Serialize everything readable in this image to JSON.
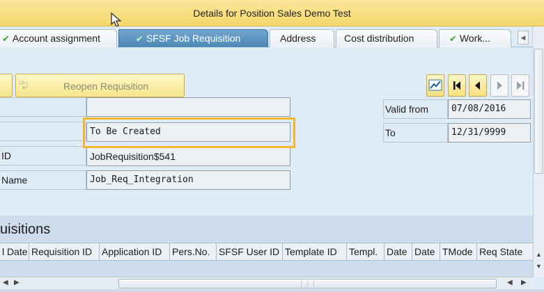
{
  "title_bar": {
    "title": "Details for Position Sales Demo Test"
  },
  "tabs": [
    {
      "label": "Account assignment",
      "checked": true,
      "active": false
    },
    {
      "label": "SFSF Job Requisition",
      "checked": true,
      "active": true
    },
    {
      "label": "Address",
      "checked": false,
      "active": false
    },
    {
      "label": "Cost distribution",
      "checked": false,
      "active": false
    },
    {
      "label": "Work...",
      "checked": true,
      "active": false
    }
  ],
  "toolbar": {
    "reopen_label": "Reopen Requisition",
    "chart_icon": "trend-chart-icon",
    "first_icon": "first-page-icon",
    "prev_icon": "previous-icon",
    "next_icon": "next-icon",
    "last_icon": "last-page-icon"
  },
  "form": {
    "fields": [
      {
        "label": "",
        "value": ""
      },
      {
        "label": "",
        "value": "To Be Created"
      },
      {
        "label": "ID",
        "value": "JobRequisition$541"
      },
      {
        "label": "Name",
        "value": "Job_Req_Integration"
      }
    ],
    "valid_from": {
      "label": "Valid from",
      "value": "07/08/2016"
    },
    "to": {
      "label": "To",
      "value": "12/31/9999"
    }
  },
  "requisitions": {
    "title": "uisitions",
    "columns": [
      "l Date",
      "Requisition ID",
      "Application ID",
      "Pers.No.",
      "SFSF User ID",
      "Template ID",
      "Templ.",
      "Date",
      "Date",
      "TMode",
      "Req State"
    ]
  },
  "colors": {
    "title_bar": "#f6d86c",
    "active_tab": "#4e88b6",
    "highlight": "#f1b632",
    "background": "#dfebf5"
  }
}
